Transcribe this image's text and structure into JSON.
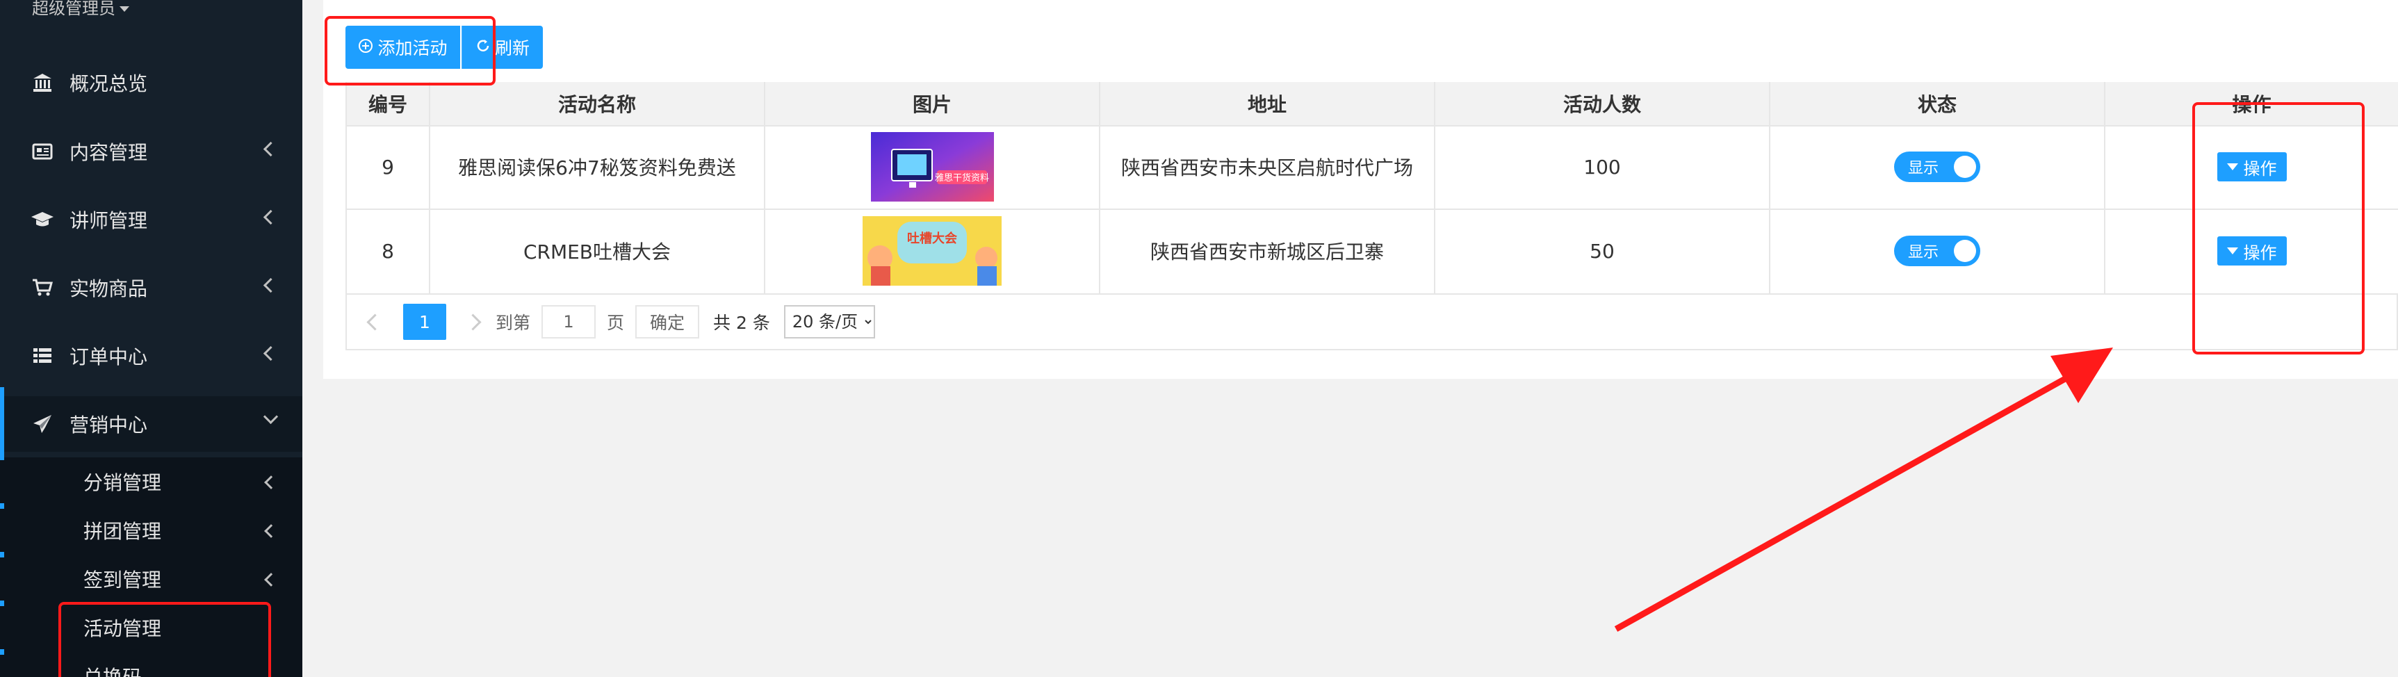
{
  "sidebar": {
    "admin_label": "超级管理员",
    "items": [
      {
        "label": "概况总览",
        "icon": "bank-icon"
      },
      {
        "label": "内容管理",
        "icon": "newspaper-icon"
      },
      {
        "label": "讲师管理",
        "icon": "graduation-cap-icon"
      },
      {
        "label": "实物商品",
        "icon": "cart-icon"
      },
      {
        "label": "订单中心",
        "icon": "list-icon"
      },
      {
        "label": "营销中心",
        "icon": "paper-plane-icon"
      }
    ],
    "sub_items": [
      {
        "label": "分销管理"
      },
      {
        "label": "拼团管理"
      },
      {
        "label": "签到管理"
      },
      {
        "label": "活动管理"
      },
      {
        "label": "兑换码"
      }
    ]
  },
  "toolbar": {
    "add_label": "添加活动",
    "refresh_label": "刷新"
  },
  "table": {
    "headers": [
      "编号",
      "活动名称",
      "图片",
      "地址",
      "活动人数",
      "状态",
      "操作"
    ],
    "rows": [
      {
        "id": "9",
        "name": "雅思阅读保6冲7秘笈资料免费送",
        "image_caption": "雅思干货资料",
        "address": "陕西省西安市未央区启航时代广场",
        "count": "100",
        "status": "显示",
        "action": "操作"
      },
      {
        "id": "8",
        "name": "CRMEB吐槽大会",
        "image_caption": "吐槽大会",
        "address": "陕西省西安市新城区后卫寨",
        "count": "50",
        "status": "显示",
        "action": "操作"
      }
    ]
  },
  "pagination": {
    "current": "1",
    "goto_label": "到第",
    "page_input": "1",
    "page_suffix": "页",
    "confirm_label": "确定",
    "total_label": "共 2 条",
    "page_size": "20 条/页"
  },
  "colors": {
    "sidebar_bg": "#15202b",
    "accent": "#1e9fff",
    "annotation": "#ff1a1a"
  }
}
